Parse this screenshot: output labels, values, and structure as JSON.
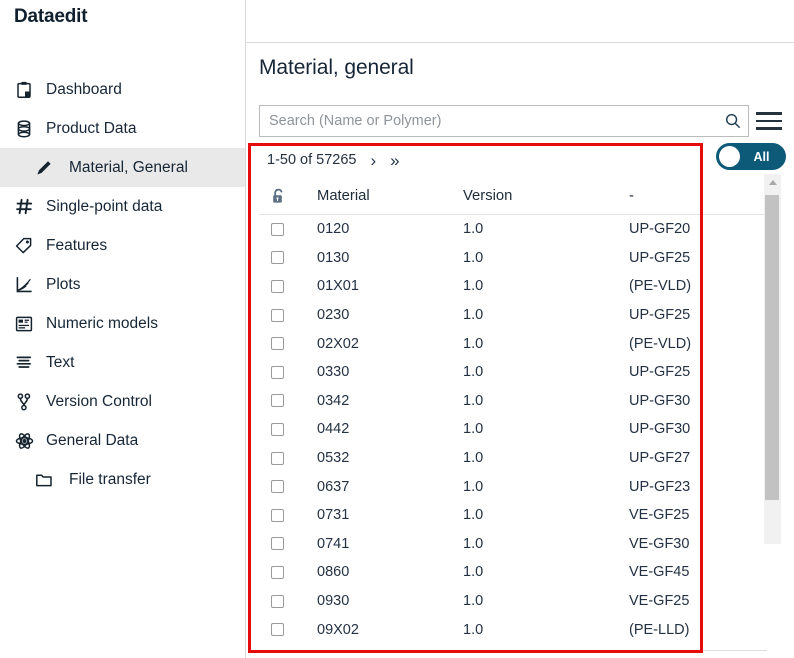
{
  "app": {
    "title": "Dataedit"
  },
  "sidebar": {
    "items": [
      {
        "label": "Dashboard",
        "icon": "clipboard-icon",
        "level": 0,
        "active": false
      },
      {
        "label": "Product Data",
        "icon": "database-icon",
        "level": 0,
        "active": false
      },
      {
        "label": "Material, General",
        "icon": "pencil-icon",
        "level": 1,
        "active": true
      },
      {
        "label": "Single-point data",
        "icon": "hash-icon",
        "level": 0,
        "active": false
      },
      {
        "label": "Features",
        "icon": "tag-icon",
        "level": 0,
        "active": false
      },
      {
        "label": "Plots",
        "icon": "chart-icon",
        "level": 0,
        "active": false
      },
      {
        "label": "Numeric models",
        "icon": "grid-icon",
        "level": 0,
        "active": false
      },
      {
        "label": "Text",
        "icon": "text-lines-icon",
        "level": 0,
        "active": false
      },
      {
        "label": "Version Control",
        "icon": "branch-icon",
        "level": 0,
        "active": false
      },
      {
        "label": "General Data",
        "icon": "atom-icon",
        "level": 0,
        "active": false
      },
      {
        "label": "File transfer",
        "icon": "folder-icon",
        "level": 1,
        "active": false
      }
    ]
  },
  "main": {
    "page_title": "Material, general",
    "search": {
      "placeholder": "Search (Name or Polymer)",
      "value": "",
      "icon": "search-icon"
    },
    "menu_icon": "hamburger-icon",
    "pagination": {
      "range": "1-50 of 57265",
      "next": "›",
      "last": "»"
    },
    "toggle": {
      "label": "All",
      "state": "on",
      "color": "#0d5a78"
    },
    "annotation": {
      "color": "#e60b0b"
    },
    "table": {
      "lock_icon": "unlock-icon",
      "columns": [
        "Material",
        "Version",
        "-"
      ],
      "rows": [
        {
          "material": "0120",
          "version": "1.0",
          "dash": "UP-GF20",
          "checked": false
        },
        {
          "material": "0130",
          "version": "1.0",
          "dash": "UP-GF25",
          "checked": false
        },
        {
          "material": "01X01",
          "version": "1.0",
          "dash": "(PE-VLD)",
          "checked": false
        },
        {
          "material": "0230",
          "version": "1.0",
          "dash": "UP-GF25",
          "checked": false
        },
        {
          "material": "02X02",
          "version": "1.0",
          "dash": "(PE-VLD)",
          "checked": false
        },
        {
          "material": "0330",
          "version": "1.0",
          "dash": "UP-GF25",
          "checked": false
        },
        {
          "material": "0342",
          "version": "1.0",
          "dash": "UP-GF30",
          "checked": false
        },
        {
          "material": "0442",
          "version": "1.0",
          "dash": "UP-GF30",
          "checked": false
        },
        {
          "material": "0532",
          "version": "1.0",
          "dash": "UP-GF27",
          "checked": false
        },
        {
          "material": "0637",
          "version": "1.0",
          "dash": "UP-GF23",
          "checked": false
        },
        {
          "material": "0731",
          "version": "1.0",
          "dash": "VE-GF25",
          "checked": false
        },
        {
          "material": "0741",
          "version": "1.0",
          "dash": "VE-GF30",
          "checked": false
        },
        {
          "material": "0860",
          "version": "1.0",
          "dash": "VE-GF45",
          "checked": false
        },
        {
          "material": "0930",
          "version": "1.0",
          "dash": "VE-GF25",
          "checked": false
        },
        {
          "material": "09X02",
          "version": "1.0",
          "dash": "(PE-LLD)",
          "checked": false
        }
      ]
    },
    "scrollbar": {
      "up_arrow_icon": "chevron-up-icon"
    }
  }
}
